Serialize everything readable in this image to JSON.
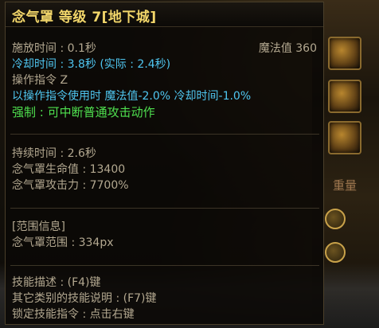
{
  "tooltip": {
    "title": "念气罩 等级 7[地下城]",
    "cast_time": "施放时间 : 0.1秒",
    "mp_cost": "魔法值 360",
    "cooldown": "冷却时间 : 3.8秒 (实际 : 2.4秒)",
    "command": "操作指令 Z",
    "command_bonus": "以操作指令使用时 魔法值-2.0% 冷却时间-1.0%",
    "force": "强制 : 可中断普通攻击动作",
    "duration": "持续时间 : 2.6秒",
    "shield_hp": "念气罩生命值 : 13400",
    "shield_atk": "念气罩攻击力 : 7700%",
    "range_header": "[范围信息]",
    "range": "念气罩范围 : 334px",
    "desc_hint": "技能描述 : (F4)键",
    "other_hint": "其它类别的技能说明 : (F7)键",
    "lock_hint": "锁定技能指令 : 点击右键"
  },
  "background": {
    "side_label": "重量"
  },
  "colors": {
    "title": "#f2d66a",
    "normal": "#b3a890",
    "highlight": "#4fc6f0",
    "force": "#4fe04f"
  }
}
